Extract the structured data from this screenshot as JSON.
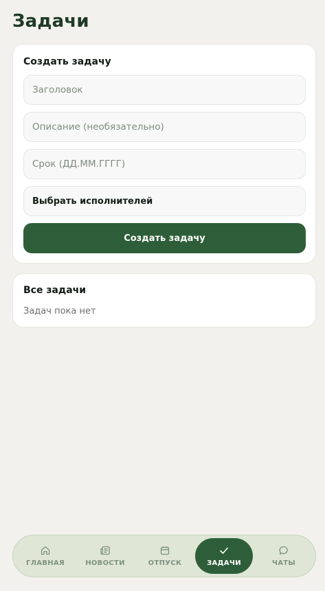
{
  "page": {
    "title": "Задачи"
  },
  "create_card": {
    "heading": "Создать задачу",
    "title_placeholder": "Заголовок",
    "description_placeholder": "Описание (необязательно)",
    "deadline_placeholder": "Срок (ДД.ММ.ГГГГ)",
    "assignees_label": "Выбрать исполнителей",
    "submit_label": "Создать задачу"
  },
  "tasks_card": {
    "heading": "Все задачи",
    "empty_text": "Задач пока нет"
  },
  "tabbar": {
    "active": "tasks",
    "items": [
      {
        "id": "home",
        "label": "ГЛАВНАЯ",
        "icon": "home-icon"
      },
      {
        "id": "news",
        "label": "НОВОСТИ",
        "icon": "newspaper-icon"
      },
      {
        "id": "vacation",
        "label": "ОТПУСК",
        "icon": "calendar-icon"
      },
      {
        "id": "tasks",
        "label": "ЗАДАЧИ",
        "icon": "check-icon"
      },
      {
        "id": "chats",
        "label": "ЧАТЫ",
        "icon": "chat-bubble-icon"
      }
    ]
  },
  "colors": {
    "background": "#f2f1ed",
    "accent": "#2e5e39",
    "tabbar_bg": "#dfe6d6",
    "tab_inactive": "#7f9281"
  }
}
